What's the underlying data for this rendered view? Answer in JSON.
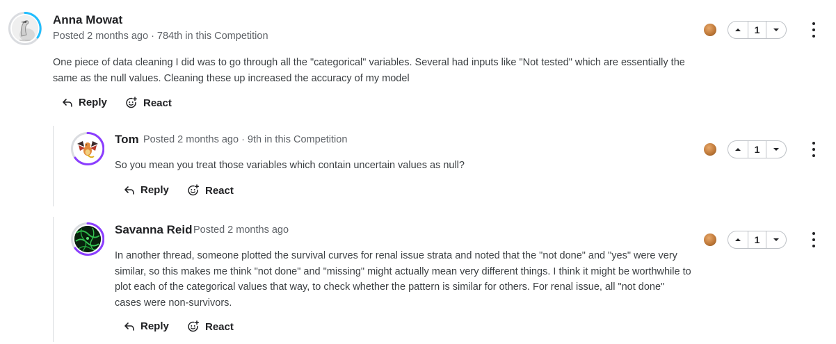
{
  "comments": [
    {
      "author": "Anna Mowat",
      "meta": "Posted 2 months ago · 784th in this Competition",
      "text": "One piece of data cleaning I did was to go through all the \"categorical\" variables. Several had inputs like \"Not tested\" which are essentially the same as the null values. Cleaning these up increased the accuracy of my model",
      "votes": "1",
      "reply_label": "Reply",
      "react_label": "React"
    },
    {
      "author": "Tom",
      "meta": "Posted 2 months ago · 9th in this Competition",
      "text": "So you mean you treat those variables which contain uncertain values as null?",
      "votes": "1",
      "reply_label": "Reply",
      "react_label": "React"
    },
    {
      "author": "Savanna Reid",
      "meta": "Posted 2 months ago",
      "text": "In another thread, someone plotted the survival curves for renal issue strata and noted that the \"not done\" and \"yes\" were very similar, so this makes me think \"not done\" and \"missing\" might actually mean very different things. I think it might be worthwhile to plot each of the categorical values that way, to check whether the pattern is similar for others. For renal issue, all \"not done\" cases were non-survivors.",
      "votes": "1",
      "reply_label": "Reply",
      "react_label": "React"
    }
  ],
  "colors": {
    "accent_ring": "#20beff",
    "reply_ring": "#8b3dff",
    "medal": "#c07a3a"
  },
  "icons": {
    "reply": "reply-arrow-icon",
    "react": "emoji-add-icon",
    "upvote": "caret-up-icon",
    "downvote": "caret-down-icon",
    "more": "more-vertical-icon",
    "medal": "bronze-medal-icon"
  }
}
